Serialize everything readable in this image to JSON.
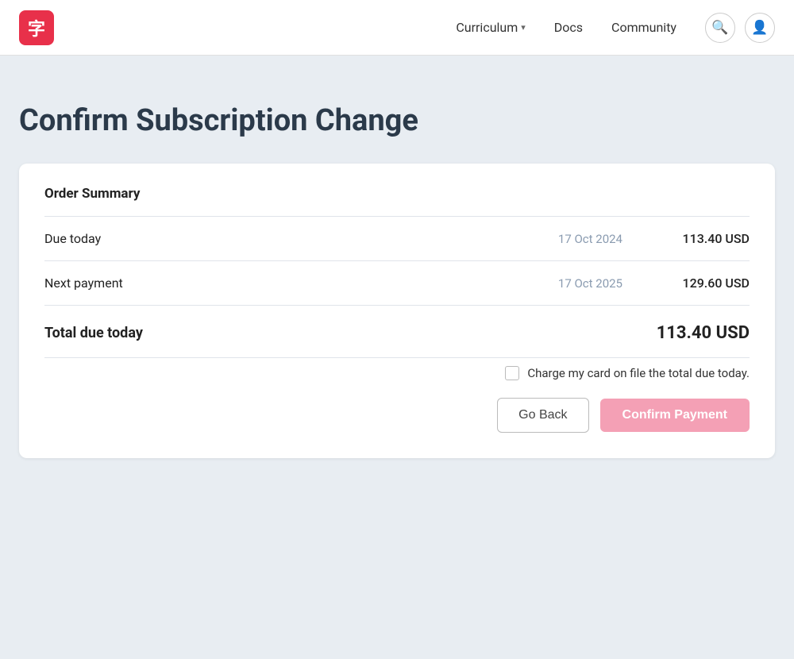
{
  "header": {
    "logo_text": "字",
    "nav": {
      "curriculum_label": "Curriculum",
      "docs_label": "Docs",
      "community_label": "Community"
    }
  },
  "page": {
    "title": "Confirm Subscription Change"
  },
  "card": {
    "order_summary_title": "Order Summary",
    "rows": [
      {
        "label": "Due today",
        "date": "17 Oct 2024",
        "amount": "113.40 USD"
      },
      {
        "label": "Next payment",
        "date": "17 Oct 2025",
        "amount": "129.60 USD"
      }
    ],
    "total_label": "Total due today",
    "total_amount": "113.40 USD",
    "checkbox_label": "Charge my card on file the total due today.",
    "go_back_label": "Go Back",
    "confirm_payment_label": "Confirm Payment"
  }
}
